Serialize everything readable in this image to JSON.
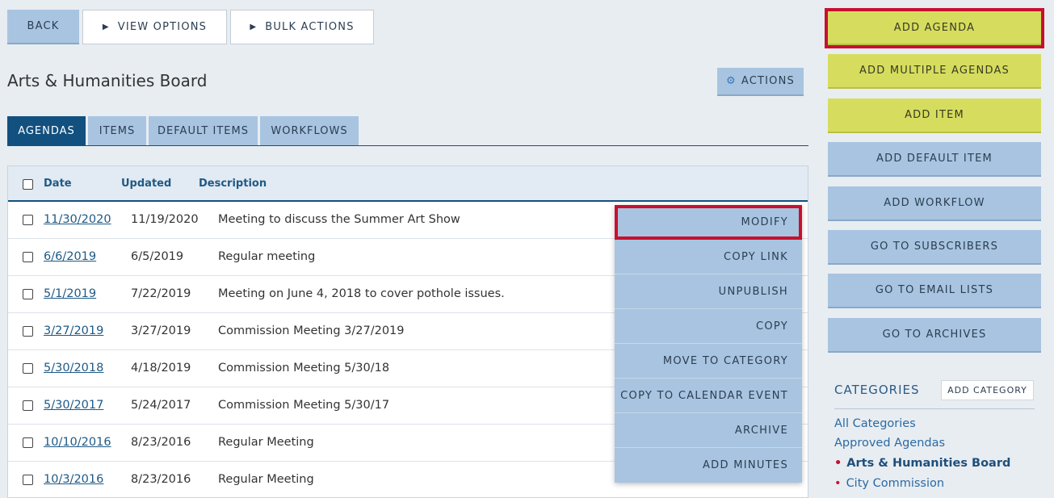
{
  "toolbar": {
    "back": "BACK",
    "view_options": "VIEW OPTIONS",
    "bulk_actions": "BULK ACTIONS"
  },
  "page": {
    "title": "Arts & Humanities Board",
    "actions": "ACTIONS"
  },
  "tabs": [
    "AGENDAS",
    "ITEMS",
    "DEFAULT ITEMS",
    "WORKFLOWS"
  ],
  "table": {
    "headers": {
      "date": "Date",
      "updated": "Updated",
      "description": "Description"
    },
    "rows": [
      {
        "date": "11/30/2020",
        "updated": "11/19/2020",
        "description": "Meeting to discuss the Summer Art Show"
      },
      {
        "date": "6/6/2019",
        "updated": "6/5/2019",
        "description": "Regular meeting"
      },
      {
        "date": "5/1/2019",
        "updated": "7/22/2019",
        "description": "Meeting on June 4, 2018 to cover pothole issues."
      },
      {
        "date": "3/27/2019",
        "updated": "3/27/2019",
        "description": "Commission Meeting 3/27/2019"
      },
      {
        "date": "5/30/2018",
        "updated": "4/18/2019",
        "description": "Commission Meeting 5/30/18"
      },
      {
        "date": "5/30/2017",
        "updated": "5/24/2017",
        "description": "Commission Meeting 5/30/17"
      },
      {
        "date": "10/10/2016",
        "updated": "8/23/2016",
        "description": "Regular Meeting"
      },
      {
        "date": "10/3/2016",
        "updated": "8/23/2016",
        "description": "Regular Meeting"
      }
    ]
  },
  "context_menu": [
    "MODIFY",
    "COPY LINK",
    "UNPUBLISH",
    "COPY",
    "MOVE TO CATEGORY",
    "COPY TO CALENDAR EVENT",
    "ARCHIVE",
    "ADD MINUTES"
  ],
  "sidebar": {
    "buttons": [
      "ADD AGENDA",
      "ADD MULTIPLE AGENDAS",
      "ADD ITEM",
      "ADD DEFAULT ITEM",
      "ADD WORKFLOW",
      "GO TO SUBSCRIBERS",
      "GO TO EMAIL LISTS",
      "GO TO ARCHIVES"
    ],
    "categories_heading": "CATEGORIES",
    "add_category": "ADD CATEGORY",
    "categories": [
      "All Categories",
      "Approved Agendas",
      "Arts & Humanities Board",
      "City Commission"
    ]
  },
  "colors": {
    "highlight": "#c8102e",
    "accent": "#12507f",
    "button_blue": "#a8c4e0",
    "button_yellow": "#d6dd5e"
  },
  "icons": {
    "view_options": "triangle-right-icon",
    "bulk_actions": "triangle-right-icon",
    "actions": "gear-icon"
  }
}
